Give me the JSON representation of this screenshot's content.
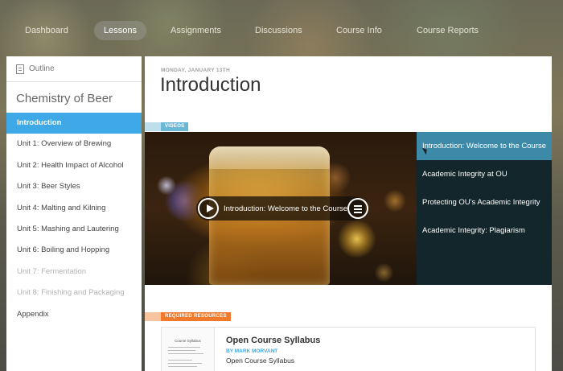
{
  "nav": {
    "items": [
      {
        "label": "Dashboard",
        "active": false
      },
      {
        "label": "Lessons",
        "active": true
      },
      {
        "label": "Assignments",
        "active": false
      },
      {
        "label": "Discussions",
        "active": false
      },
      {
        "label": "Course Info",
        "active": false
      },
      {
        "label": "Course Reports",
        "active": false
      }
    ]
  },
  "sidebar": {
    "outline_label": "Outline",
    "course_title": "Chemistry of Beer",
    "items": [
      {
        "label": "Introduction",
        "state": "active"
      },
      {
        "label": "Unit 1: Overview of Brewing",
        "state": "normal"
      },
      {
        "label": "Unit 2: Health Impact of Alcohol",
        "state": "normal"
      },
      {
        "label": "Unit 3: Beer Styles",
        "state": "normal"
      },
      {
        "label": "Unit 4: Malting and Kilning",
        "state": "normal"
      },
      {
        "label": "Unit 5: Mashing and Lautering",
        "state": "normal"
      },
      {
        "label": "Unit 6: Boiling and Hopping",
        "state": "normal"
      },
      {
        "label": "Unit 7: Fermentation",
        "state": "dim"
      },
      {
        "label": "Unit 8: Finishing and Packaging",
        "state": "dim"
      },
      {
        "label": "Appendix",
        "state": "normal"
      }
    ]
  },
  "main": {
    "date": "MONDAY, JANUARY 13TH",
    "title": "Introduction",
    "videos_tag": "VIDEOS",
    "video": {
      "now_playing": "Introduction: Welcome to the Course"
    },
    "playlist": [
      {
        "label": "Introduction: Welcome to the Course",
        "active": true
      },
      {
        "label": "Academic Integrity at OU",
        "active": false
      },
      {
        "label": "Protecting OU's Academic Integrity",
        "active": false
      },
      {
        "label": "Academic Integrity: Plagiarism",
        "active": false
      }
    ],
    "resources_tag": "REQUIRED RESOURCES",
    "resource": {
      "thumb_title": "Course Syllabus",
      "title": "Open Course Syllabus",
      "author": "BY MARK MORVANT",
      "description": "Open Course Syllabus"
    }
  },
  "colors": {
    "accent": "#3ea9e6",
    "playlist_bg": "#13262b",
    "playlist_active": "#3c8aa8",
    "required_tag": "#f0792b",
    "videos_tag": "#6bb8d6"
  }
}
